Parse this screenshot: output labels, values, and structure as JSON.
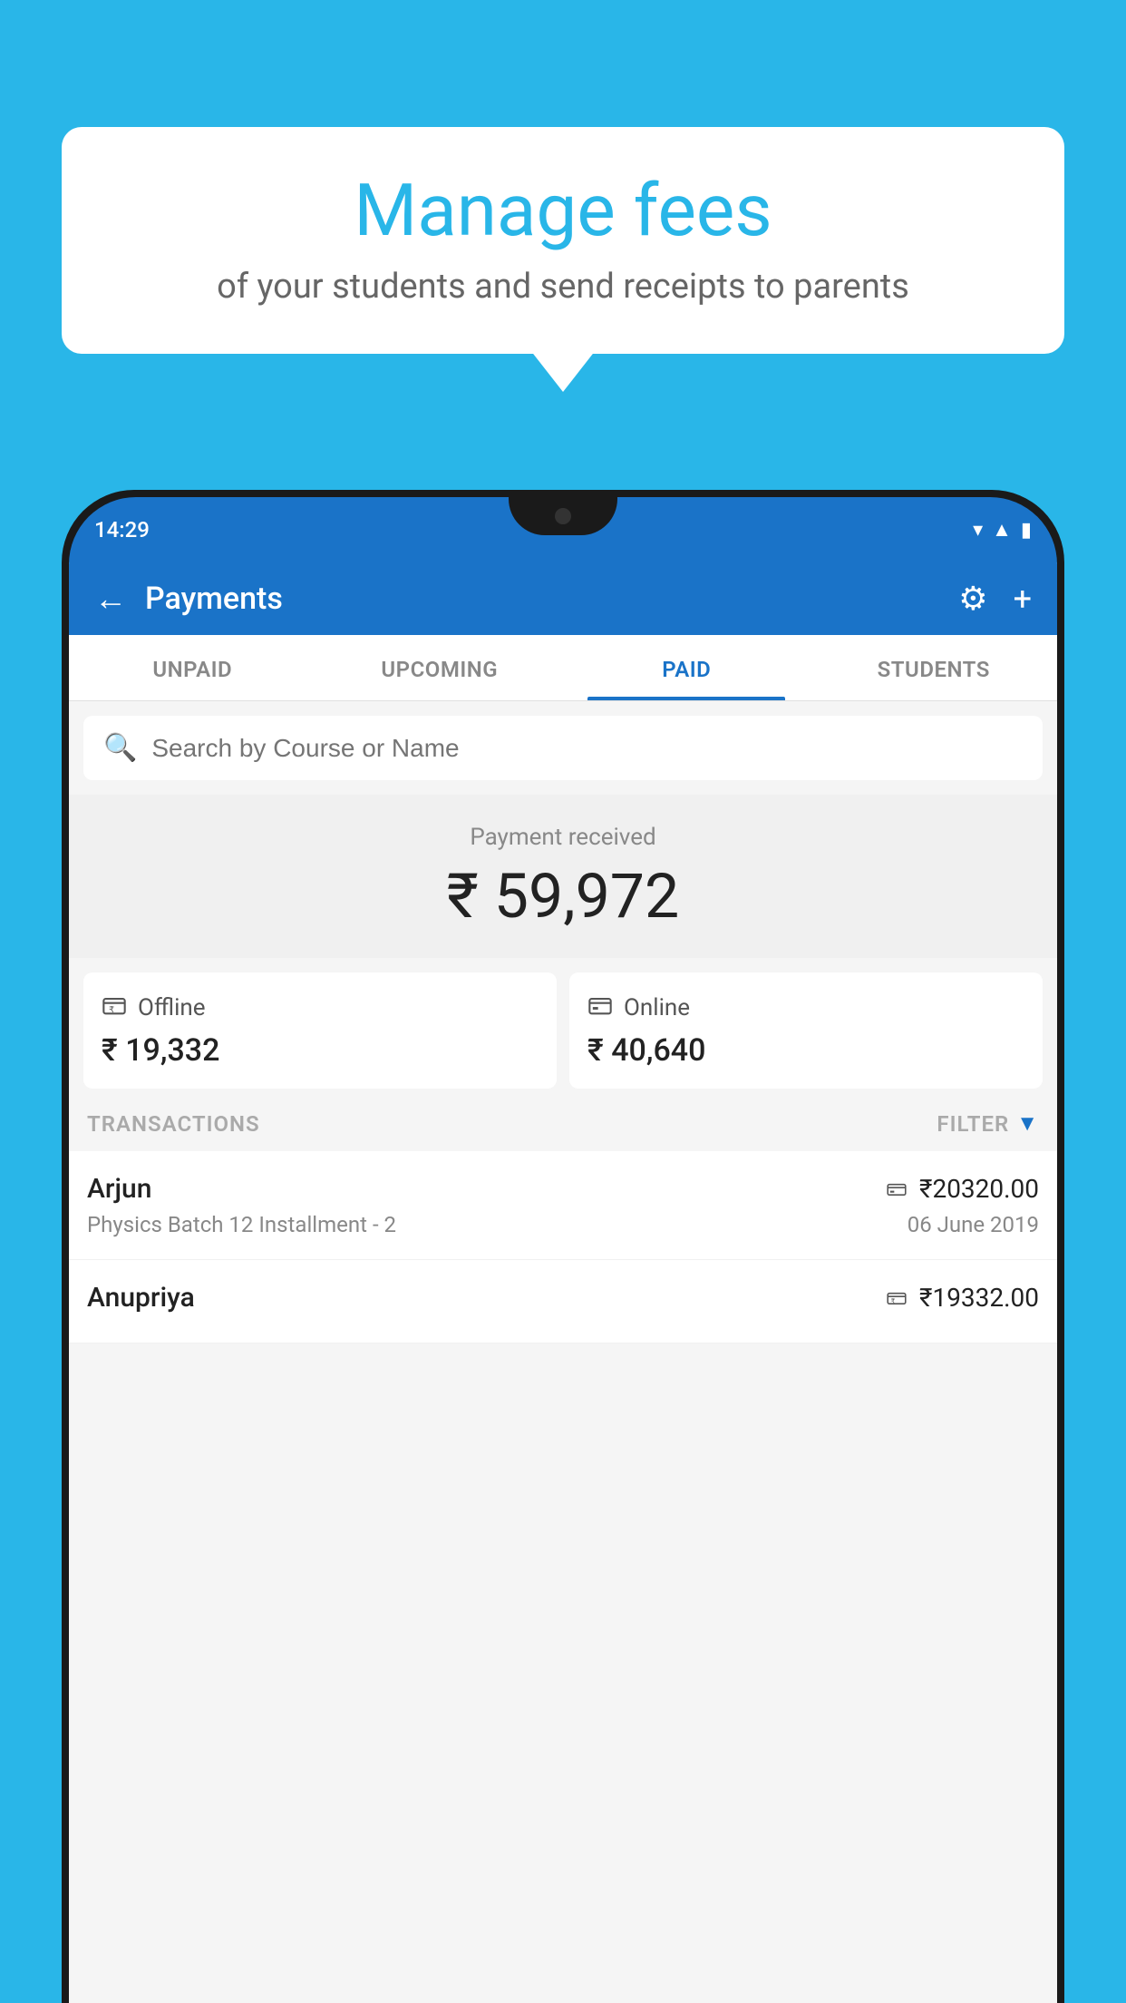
{
  "background_color": "#29b6e8",
  "tooltip": {
    "title": "Manage fees",
    "subtitle": "of your students and send receipts to parents"
  },
  "status_bar": {
    "time": "14:29",
    "icons": [
      "wifi",
      "signal",
      "battery"
    ]
  },
  "header": {
    "title": "Payments",
    "back_label": "←",
    "gear_label": "⚙",
    "plus_label": "+"
  },
  "tabs": [
    {
      "label": "UNPAID",
      "active": false
    },
    {
      "label": "UPCOMING",
      "active": false
    },
    {
      "label": "PAID",
      "active": true
    },
    {
      "label": "STUDENTS",
      "active": false
    }
  ],
  "search": {
    "placeholder": "Search by Course or Name"
  },
  "payment_summary": {
    "label": "Payment received",
    "amount": "₹ 59,972"
  },
  "payment_cards": [
    {
      "type": "Offline",
      "amount": "₹ 19,332",
      "icon": "💳"
    },
    {
      "type": "Online",
      "amount": "₹ 40,640",
      "icon": "💳"
    }
  ],
  "transactions_section": {
    "label": "TRANSACTIONS",
    "filter_label": "FILTER"
  },
  "transactions": [
    {
      "name": "Arjun",
      "amount": "₹20320.00",
      "course": "Physics Batch 12 Installment - 2",
      "date": "06 June 2019",
      "icon": "card"
    },
    {
      "name": "Anupriya",
      "amount": "₹19332.00",
      "course": "",
      "date": "",
      "icon": "cash"
    }
  ]
}
